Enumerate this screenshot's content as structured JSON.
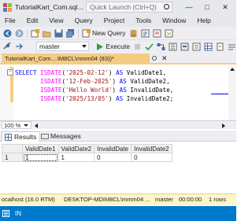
{
  "window": {
    "title": "TutorialKart_Com.sql...",
    "quick_launch_placeholder": "Quick Launch (Ctrl+Q)",
    "minimize": "—",
    "maximize": "□",
    "close": "✕"
  },
  "menu": {
    "items": [
      "File",
      "Edit",
      "View",
      "Query",
      "Project",
      "Tools",
      "Window",
      "Help"
    ]
  },
  "toolbar": {
    "new_query_label": "New Query",
    "database": "master",
    "execute_label": "Execute"
  },
  "tab": {
    "title": "TutorialKart_Com....IM8CL\\mmm04 (83))*",
    "close": "✕"
  },
  "editor": {
    "collapse_marker": "−",
    "lines": [
      [
        [
          "kw",
          "SELECT "
        ],
        [
          "fn",
          "ISDATE"
        ],
        [
          "",
          "("
        ],
        [
          "str",
          "'2025-02-12'"
        ],
        [
          "",
          ") "
        ],
        [
          "kw",
          "AS"
        ],
        [
          "",
          " ValidDate1,"
        ]
      ],
      [
        [
          "",
          "       "
        ],
        [
          "fn",
          "ISDATE"
        ],
        [
          "",
          "("
        ],
        [
          "str",
          "'12-Feb-2025'"
        ],
        [
          "",
          ") "
        ],
        [
          "kw",
          "AS"
        ],
        [
          "",
          " ValidDate2,"
        ]
      ],
      [
        [
          "",
          "       "
        ],
        [
          "fn",
          "ISDATE"
        ],
        [
          "",
          "("
        ],
        [
          "str",
          "'Hello World'"
        ],
        [
          "",
          ") "
        ],
        [
          "kw",
          "AS"
        ],
        [
          "",
          " InvalidDate,"
        ]
      ],
      [
        [
          "",
          "       "
        ],
        [
          "fn",
          "ISDATE"
        ],
        [
          "",
          "("
        ],
        [
          "str",
          "'2025/13/05'"
        ],
        [
          "",
          ") "
        ],
        [
          "kw",
          "AS"
        ],
        [
          "",
          " InvalidDate2;"
        ]
      ]
    ]
  },
  "zoom": {
    "value": "100 %"
  },
  "results_tabs": {
    "results": "Results",
    "messages": "Messages"
  },
  "results_grid": {
    "columns": [
      "ValidDate1",
      "ValidDate2",
      "InvalidDate",
      "InvalidDate2"
    ],
    "rows": [
      {
        "rownum": "1",
        "values": [
          "1",
          "1",
          "0",
          "0"
        ]
      }
    ]
  },
  "status_grid": {
    "server": "ocalhost (16.0 RTM)",
    "user": "DESKTOP-MDIM8CL\\mmm04 ...",
    "database": "master",
    "elapsed": "00:00:00",
    "rows": "1 rows"
  },
  "statusbar": {
    "mode": "IN"
  }
}
